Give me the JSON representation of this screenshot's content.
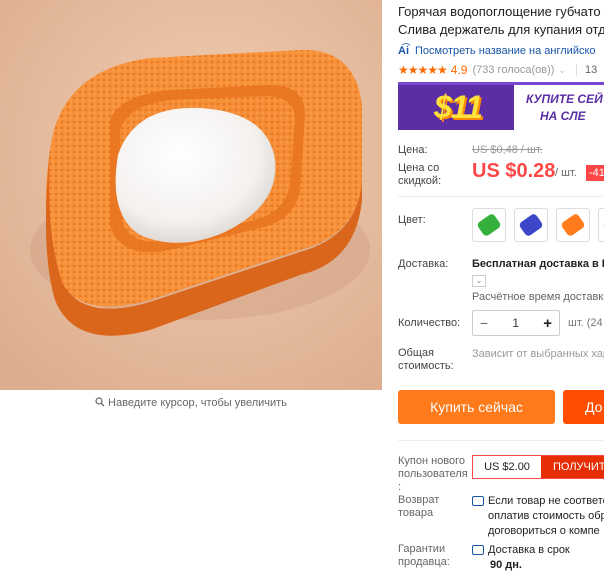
{
  "image": {
    "zoom_hint": "Наведите курсор, чтобы увеличить"
  },
  "product": {
    "title_line1": "Горячая водопоглощение губчато",
    "title_line2": "Слива держатель для купания отд",
    "translate_link": "Посмотреть название на английско",
    "rating": {
      "stars": "★★★★★",
      "score": "4.9",
      "votes": "(733 голоса(ов))",
      "orders": "13"
    }
  },
  "banner": {
    "amount": "$11",
    "line1": "КУПИТЕ СЕЙ",
    "line2": "НА СЛЕ"
  },
  "price": {
    "label": "Цена:",
    "old": "US $0,48 / шт.",
    "discount_label_1": "Цена со",
    "discount_label_2": "скидкой:",
    "value": "US $0.28",
    "per": "/ шт.",
    "badge": "-41"
  },
  "color": {
    "label": "Цвет:",
    "swatches": [
      {
        "name": "green",
        "hex": "#35b03c"
      },
      {
        "name": "blue",
        "hex": "#3c46c8"
      },
      {
        "name": "orange",
        "hex": "#ff7b1c"
      },
      {
        "name": "pink",
        "hex": "#ff2d70"
      }
    ]
  },
  "shipping": {
    "label": "Доставка:",
    "value": "Бесплатная доставка в R",
    "estimate": "Расчётное время доставки"
  },
  "quantity": {
    "label": "Количество:",
    "minus": "−",
    "value": "1",
    "plus": "+",
    "available": "шт. (24"
  },
  "total": {
    "label_1": "Общая",
    "label_2": "стоимость:",
    "note": "Зависит от выбранных хар"
  },
  "actions": {
    "buy_now": "Купить сейчас",
    "cart": "До"
  },
  "coupon": {
    "label_1": "Купон нового",
    "label_2": "пользователя",
    "label_3": ":",
    "value": "US $2.00",
    "get": "ПОЛУЧИТ"
  },
  "returns": {
    "label_1": "Возврат",
    "label_2": "товара",
    "line1": "Если товар не соответс",
    "line2": "оплатив стоимость обр",
    "line3": "договориться о компе"
  },
  "warranty": {
    "label_1": "Гарантии",
    "label_2": "продавца:",
    "line1": "Доставка в срок",
    "line2": "90 дн."
  },
  "colors": {
    "accent": "#ff4747",
    "buy": "#ff7a1a",
    "link": "#1a55a6",
    "star": "#ff6a00"
  }
}
